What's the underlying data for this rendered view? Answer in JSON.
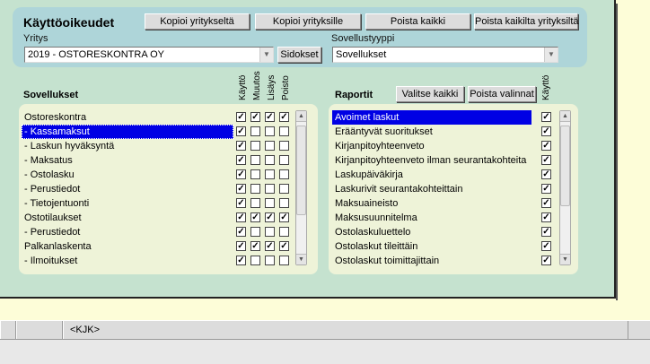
{
  "header": {
    "title": "Käyttöoikeudet",
    "buttons": [
      "Kopioi yritykseltä",
      "Kopioi yrityksille",
      "Poista kaikki",
      "Poista kaikilta yrityksiltä"
    ],
    "company_label": "Yritys",
    "company_value": "2019 - OSTORESKONTRA OY",
    "links_button": "Sidokset",
    "apptype_label": "Sovellustyyppi",
    "apptype_value": "Sovellukset"
  },
  "apps": {
    "title": "Sovellukset",
    "col_headers": [
      "Käyttö",
      "Muutos",
      "Lisäys",
      "Poisto"
    ],
    "rows": [
      {
        "label": "Ostoreskontra",
        "checks": [
          true,
          true,
          true,
          true
        ],
        "selected": false
      },
      {
        "label": "- Kassamaksut",
        "checks": [
          true,
          false,
          false,
          false
        ],
        "selected": true
      },
      {
        "label": "- Laskun hyväksyntä",
        "checks": [
          true,
          false,
          false,
          false
        ],
        "selected": false
      },
      {
        "label": "- Maksatus",
        "checks": [
          true,
          false,
          false,
          false
        ],
        "selected": false
      },
      {
        "label": "- Ostolasku",
        "checks": [
          true,
          false,
          false,
          false
        ],
        "selected": false
      },
      {
        "label": "- Perustiedot",
        "checks": [
          true,
          false,
          false,
          false
        ],
        "selected": false
      },
      {
        "label": "- Tietojentuonti",
        "checks": [
          true,
          false,
          false,
          false
        ],
        "selected": false
      },
      {
        "label": "Ostotilaukset",
        "checks": [
          true,
          true,
          true,
          true
        ],
        "selected": false
      },
      {
        "label": "- Perustiedot",
        "checks": [
          true,
          false,
          false,
          false
        ],
        "selected": false
      },
      {
        "label": "Palkanlaskenta",
        "checks": [
          true,
          true,
          true,
          true
        ],
        "selected": false
      },
      {
        "label": "- Ilmoitukset",
        "checks": [
          true,
          false,
          false,
          false
        ],
        "selected": false
      }
    ]
  },
  "reports": {
    "title": "Raportit",
    "select_all": "Valitse kaikki",
    "remove_selected": "Poista valinnat",
    "col_header": "Käyttö",
    "rows": [
      {
        "label": "Avoimet laskut",
        "check": true,
        "selected": true
      },
      {
        "label": "Erääntyvät suoritukset",
        "check": true,
        "selected": false
      },
      {
        "label": "Kirjanpitoyhteenveto",
        "check": true,
        "selected": false
      },
      {
        "label": "Kirjanpitoyhteenveto ilman seurantakohteita",
        "check": true,
        "selected": false
      },
      {
        "label": "Laskupäiväkirja",
        "check": true,
        "selected": false
      },
      {
        "label": "Laskurivit seurantakohteittain",
        "check": true,
        "selected": false
      },
      {
        "label": "Maksuaineisto",
        "check": true,
        "selected": false
      },
      {
        "label": "Maksusuunnitelma",
        "check": true,
        "selected": false
      },
      {
        "label": "Ostolaskuluettelo",
        "check": true,
        "selected": false
      },
      {
        "label": "Ostolaskut tileittäin",
        "check": true,
        "selected": false
      },
      {
        "label": "Ostolaskut toimittajittain",
        "check": true,
        "selected": false
      }
    ]
  },
  "status": {
    "user": "<KJK>"
  },
  "colors": {
    "window_bg": "#c5e2cf",
    "header_bg": "#aed5d9",
    "selection": "#0000e4"
  }
}
